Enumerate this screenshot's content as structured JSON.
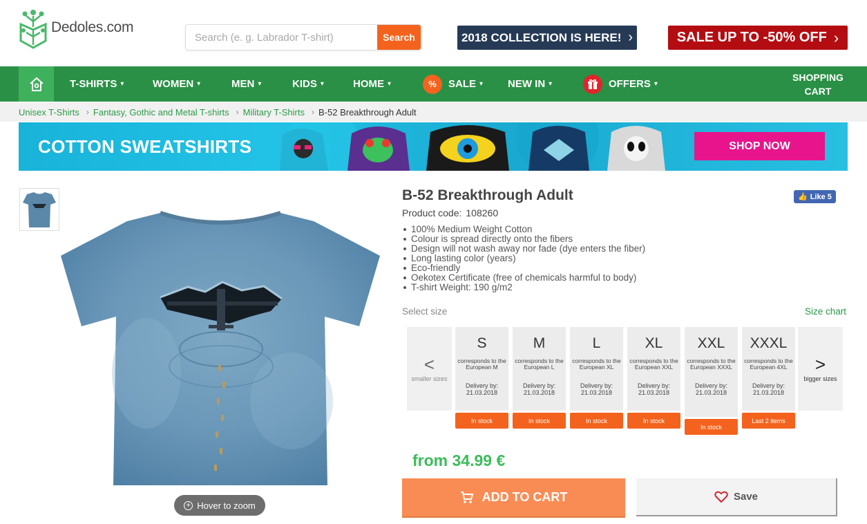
{
  "header": {
    "logo_text": "Dedoles.com",
    "search_placeholder": "Search (e. g. Labrador T-shirt)",
    "search_button": "Search",
    "promo_collection": "2018 COLLECTION IS HERE!",
    "promo_sale": "SALE UP TO -50% OFF"
  },
  "nav": {
    "items": [
      {
        "label": "T-SHIRTS"
      },
      {
        "label": "WOMEN"
      },
      {
        "label": "MEN"
      },
      {
        "label": "KIDS"
      },
      {
        "label": "HOME"
      },
      {
        "label": "SALE",
        "badge": "%"
      },
      {
        "label": "NEW IN"
      },
      {
        "label": "OFFERS"
      }
    ],
    "cart_line1": "SHOPPING",
    "cart_line2": "CART"
  },
  "breadcrumb": {
    "items": [
      "Unisex T-Shirts",
      "Fantasy, Gothic and Metal T-shirts",
      "Military T-Shirts"
    ],
    "current": "B-52 Breakthrough Adult"
  },
  "banner": {
    "title": "COTTON SWEATSHIRTS",
    "button": "SHOP NOW"
  },
  "product": {
    "title": "B-52 Breakthrough Adult",
    "code_label": "Product code:",
    "code_value": "108260",
    "fb_like": "Like 5",
    "features": [
      "100% Medium Weight Cotton",
      "Colour is spread directly onto the fibers",
      "Design will not wash away nor fade (dye enters the fiber)",
      "Long lasting color (years)",
      "Eco-friendly",
      "Oekotex Certificate (free of chemicals harmful to body)",
      "T-shirt Weight: 190 g/m2"
    ],
    "zoom_hint": "Hover to zoom",
    "select_size": "Select size",
    "size_chart": "Size chart",
    "smaller_sizes": "smaller sizes",
    "bigger_sizes": "bigger sizes",
    "sizes": [
      {
        "size": "S",
        "eq": "corresponds to the European M",
        "delivery": "Delivery by: 21.03.2018",
        "stock": "In stock"
      },
      {
        "size": "M",
        "eq": "corresponds to the European L",
        "delivery": "Delivery by: 21.03.2018",
        "stock": "In stock"
      },
      {
        "size": "L",
        "eq": "corresponds to the European XL",
        "delivery": "Delivery by: 21.03.2018",
        "stock": "In stock"
      },
      {
        "size": "XL",
        "eq": "corresponds to the European XXL",
        "delivery": "Delivery by: 21.03.2018",
        "stock": "In stock"
      },
      {
        "size": "XXL",
        "eq": "corresponds to the European XXXL",
        "delivery": "Delivery by: 21.03.2018",
        "stock": "In stock"
      },
      {
        "size": "XXXL",
        "eq": "corresponds to the European 4XL",
        "delivery": "Delivery by: 21.03.2018",
        "stock": "Last 2 items"
      }
    ],
    "price": "from 34.99 €",
    "add_to_cart": "ADD TO CART",
    "save": "Save"
  },
  "colors": {
    "nav_green": "#2a9046",
    "accent_orange": "#f4631d",
    "price_green": "#3dbb5b",
    "link_green": "#2a9a47"
  }
}
